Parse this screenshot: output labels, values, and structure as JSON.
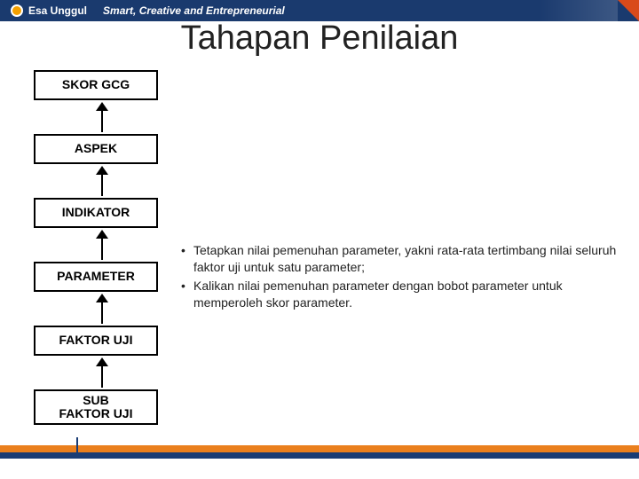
{
  "header": {
    "logo_text": "Esa Unggul",
    "tagline": "Smart, Creative and Entrepreneurial"
  },
  "title": "Tahapan Penilaian",
  "boxes": {
    "b1": "SKOR GCG",
    "b2": "ASPEK",
    "b3": "INDIKATOR",
    "b4": "PARAMETER",
    "b5": "FAKTOR UJI",
    "b6": "SUB\nFAKTOR UJI"
  },
  "bullets": [
    "Tetapkan nilai pemenuhan parameter, yakni rata-rata tertimbang nilai seluruh faktor uji untuk satu parameter;",
    "Kalikan nilai pemenuhan parameter dengan bobot parameter untuk memperoleh skor parameter."
  ]
}
